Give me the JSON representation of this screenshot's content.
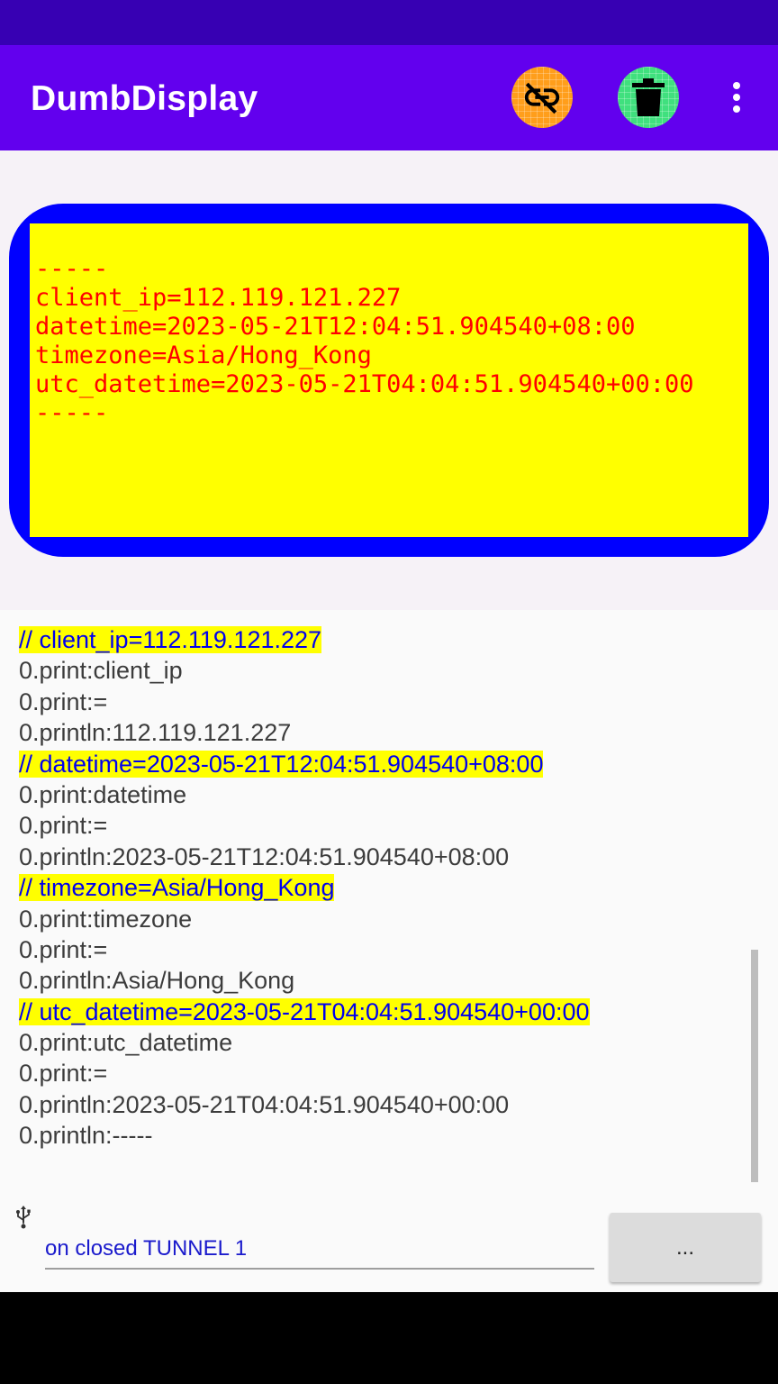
{
  "app_bar": {
    "title": "DumbDisplay",
    "actions": [
      {
        "icon": "link-off-icon",
        "color": "#ff9e1b"
      },
      {
        "icon": "trash-icon",
        "color": "#40e07e"
      },
      {
        "icon": "more-vert-icon"
      }
    ]
  },
  "display": {
    "frame_color": "#0000ff",
    "screen_color": "#ffff00",
    "text_color": "#ff0000",
    "lines": [
      "-----",
      "client_ip=112.119.121.227",
      "datetime=2023-05-21T12:04:51.904540+08:00",
      "timezone=Asia/Hong_Kong",
      "utc_datetime=2023-05-21T04:04:51.904540+00:00",
      "-----"
    ]
  },
  "log": {
    "lines": [
      {
        "text": "// client_ip=112.119.121.227",
        "highlight": true
      },
      {
        "text": "0.print:client_ip"
      },
      {
        "text": "0.print:="
      },
      {
        "text": "0.println:112.119.121.227"
      },
      {
        "text": "// datetime=2023-05-21T12:04:51.904540+08:00",
        "highlight": true
      },
      {
        "text": "0.print:datetime"
      },
      {
        "text": "0.print:="
      },
      {
        "text": "0.println:2023-05-21T12:04:51.904540+08:00"
      },
      {
        "text": "// timezone=Asia/Hong_Kong",
        "highlight": true
      },
      {
        "text": "0.print:timezone"
      },
      {
        "text": "0.print:="
      },
      {
        "text": "0.println:Asia/Hong_Kong"
      },
      {
        "text": "// utc_datetime=2023-05-21T04:04:51.904540+00:00",
        "highlight": true
      },
      {
        "text": "0.print:utc_datetime"
      },
      {
        "text": "0.print:="
      },
      {
        "text": "0.println:2023-05-21T04:04:51.904540+00:00"
      },
      {
        "text": "0.println:-----"
      }
    ]
  },
  "footer": {
    "connection_icon": "usb-icon",
    "status_text": "on closed TUNNEL 1",
    "more_button_label": "..."
  }
}
